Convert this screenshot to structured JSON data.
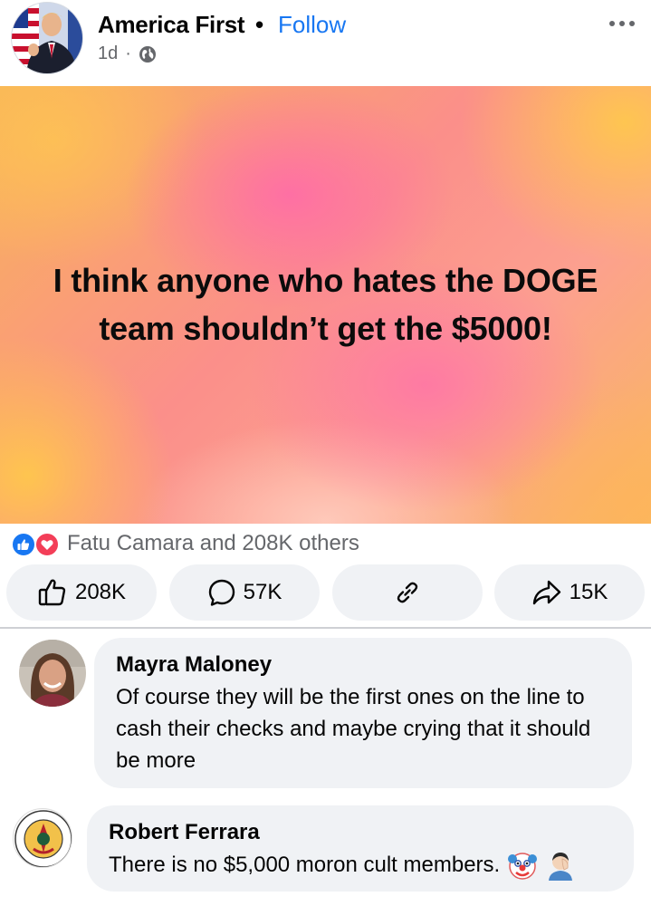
{
  "post": {
    "page_name": "America First",
    "separator": "•",
    "follow_label": "Follow",
    "time": "1d",
    "time_separator": "·",
    "privacy_icon": "globe-icon",
    "more_icon": "more-dots-icon"
  },
  "banner": {
    "text": "I think anyone who hates the DOGE team shouldn’t get the $5000!"
  },
  "reactions": {
    "icons": [
      "like-reaction-icon",
      "love-reaction-icon"
    ],
    "summary": "Fatu Camara and 208K others"
  },
  "actions": {
    "like_count": "208K",
    "comment_count": "57K",
    "share_count": "15K"
  },
  "comments": [
    {
      "author": "Mayra Maloney",
      "text": "Of course they will be the first ones on the line to cash their checks and maybe crying that it should be more"
    },
    {
      "author": "Robert Ferrara",
      "text": "There is no $5,000 moron cult members.",
      "emojis": [
        "clown-face-emoji",
        "facepalm-emoji"
      ]
    }
  ],
  "colors": {
    "accent": "#1877f2",
    "like": "#1877f2",
    "love": "#f33e58",
    "muted_text": "#65676b",
    "button_bg": "#f0f2f5"
  }
}
